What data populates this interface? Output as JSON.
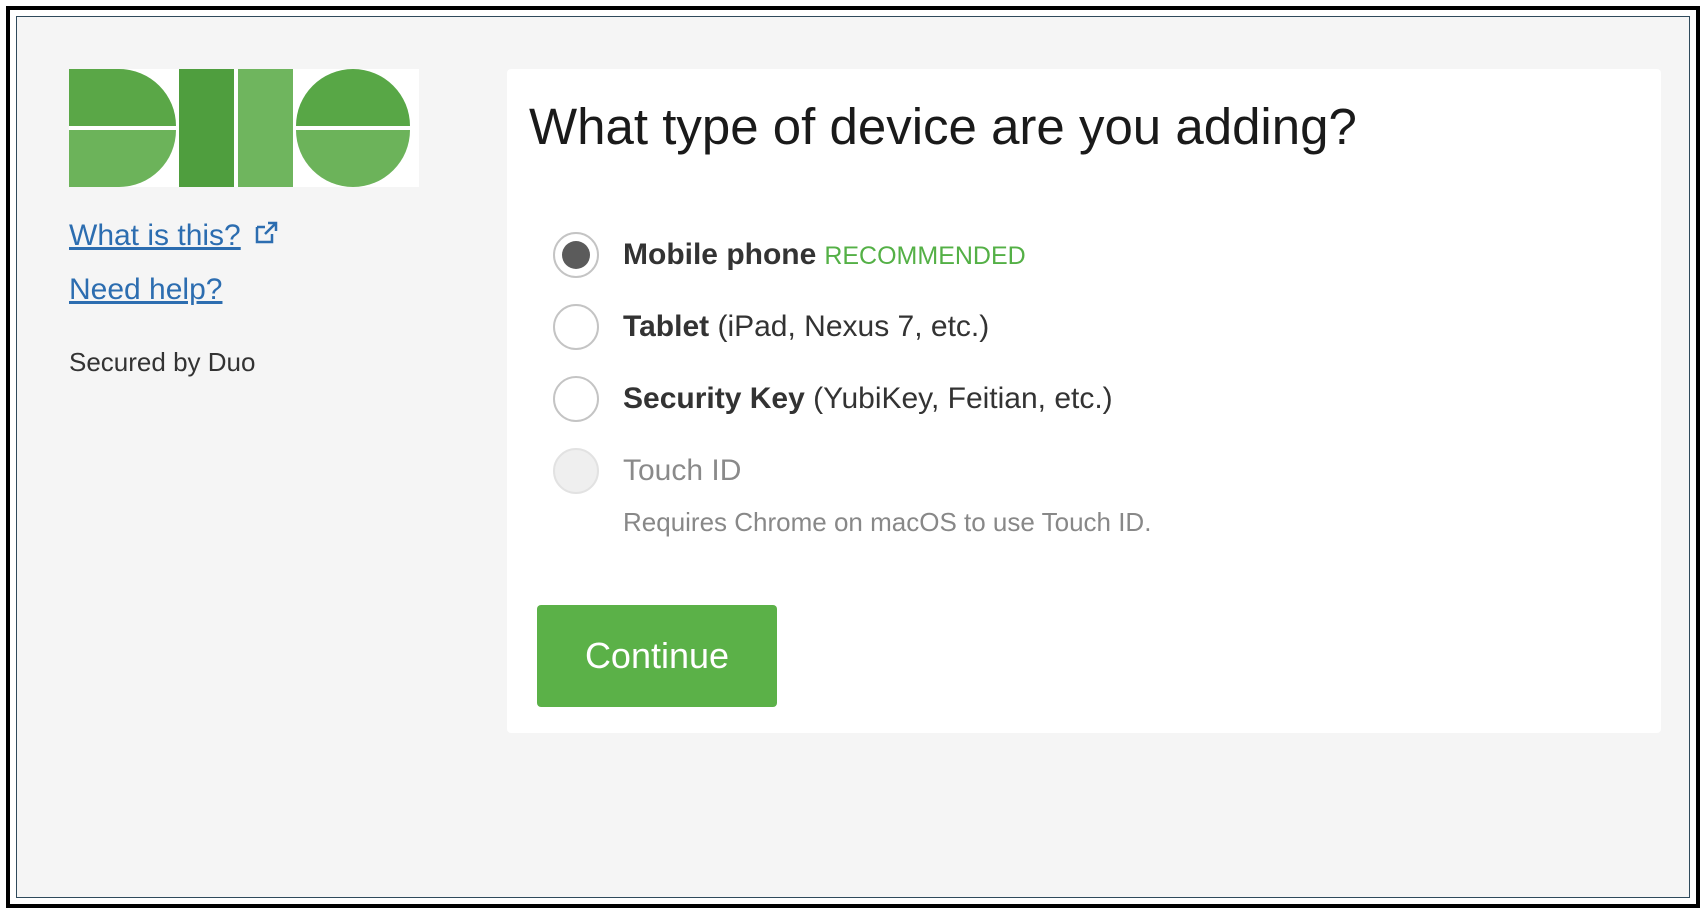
{
  "sidebar": {
    "logo_alt": "DUO",
    "links": [
      {
        "label": "What is this?",
        "icon": "external-link-icon"
      },
      {
        "label": "Need help?"
      }
    ],
    "secured_by": "Secured by Duo"
  },
  "main": {
    "title": "What type of device are you adding?",
    "options": [
      {
        "label": "Mobile phone",
        "detail": "",
        "badge": "RECOMMENDED",
        "checked": true,
        "disabled": false
      },
      {
        "label": "Tablet",
        "detail": " (iPad, Nexus 7, etc.)",
        "checked": false,
        "disabled": false
      },
      {
        "label": "Security Key",
        "detail": " (YubiKey, Feitian, etc.)",
        "checked": false,
        "disabled": false
      },
      {
        "label": "Touch ID",
        "detail": "",
        "checked": false,
        "disabled": true
      }
    ],
    "touch_id_hint": "Requires Chrome on macOS to use Touch ID.",
    "continue_label": "Continue"
  },
  "colors": {
    "brand_green": "#5bb148",
    "brand_green_dark": "#4a9d3a",
    "brand_green_light": "#6cbb5b",
    "link_blue": "#2c6db0",
    "recommended_green": "#54b046"
  }
}
